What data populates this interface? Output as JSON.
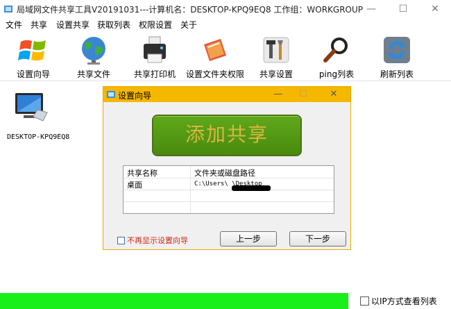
{
  "window": {
    "title": "局域网文件共享工具V20191031---计算机名：DESKTOP-KPQ9EQ8  工作组：WORKGROUP",
    "minimize": "—",
    "maximize": "☐",
    "close": "✕"
  },
  "menu": [
    {
      "label": "文件"
    },
    {
      "label": "共享"
    },
    {
      "label": "设置共享"
    },
    {
      "label": "获取列表"
    },
    {
      "label": "权限设置"
    },
    {
      "label": "关于"
    }
  ],
  "toolbar": [
    {
      "label": "设置向导",
      "icon": "windows-logo-icon"
    },
    {
      "label": "共享文件",
      "icon": "globe-icon"
    },
    {
      "label": "共享打印机",
      "icon": "printer-icon"
    },
    {
      "label": "设置文件夹权限",
      "icon": "folder-permission-icon"
    },
    {
      "label": "共享设置",
      "icon": "tools-icon"
    },
    {
      "label": "ping列表",
      "icon": "magnifier-icon"
    },
    {
      "label": "刷新列表",
      "icon": "refresh-icon"
    }
  ],
  "computers": [
    {
      "name": "DESKTOP-KPQ9EQ8",
      "icon": "computer-icon"
    }
  ],
  "dialog": {
    "title": "设置向导",
    "minimize": "—",
    "maximize": "☐",
    "close": "✕",
    "add_share_label": "添加共享",
    "list": {
      "headers": [
        "共享名称",
        "文件夹或磁盘路径"
      ],
      "rows": [
        {
          "name": "桌面",
          "path": "C:\\Users\\        \\Desktop"
        }
      ]
    },
    "no_show_label": "不再显示设置向导",
    "prev_label": "上一步",
    "next_label": "下一步"
  },
  "status": {
    "progress_percent": 100,
    "ip_view_label": "以IP方式查看列表"
  },
  "colors": {
    "dialog_title_bg": "#f6b700",
    "add_share_button": "#5a9e17",
    "progress_fill": "#19f019",
    "warning_text": "#d0281a"
  }
}
